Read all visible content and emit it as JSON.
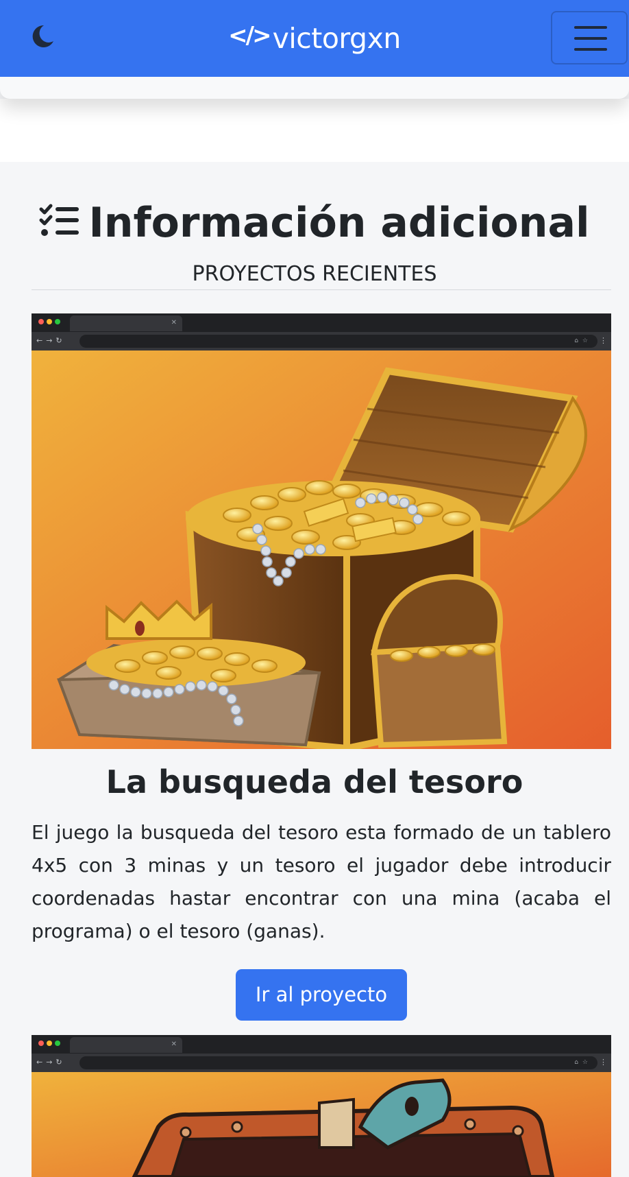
{
  "navbar": {
    "brand_code": "</>",
    "brand_name": "victorgxn",
    "theme_icon": "moon-icon",
    "menu_icon": "hamburger-menu-icon",
    "color": "#3573f0"
  },
  "section": {
    "title": "Información adicional",
    "title_icon": "list-check-icon",
    "subtitle": "PROYECTOS RECIENTES"
  },
  "projects": [
    {
      "title": "La busqueda del tesoro",
      "description": "El juego la busqueda del tesoro esta formado de un tablero 4x5 con 3 minas y un tesoro el jugador debe introducir coordenadas hastar encontrar con una mina (acaba el programa) o el tesoro (ganas).",
      "button_label": "Ir al proyecto"
    }
  ]
}
